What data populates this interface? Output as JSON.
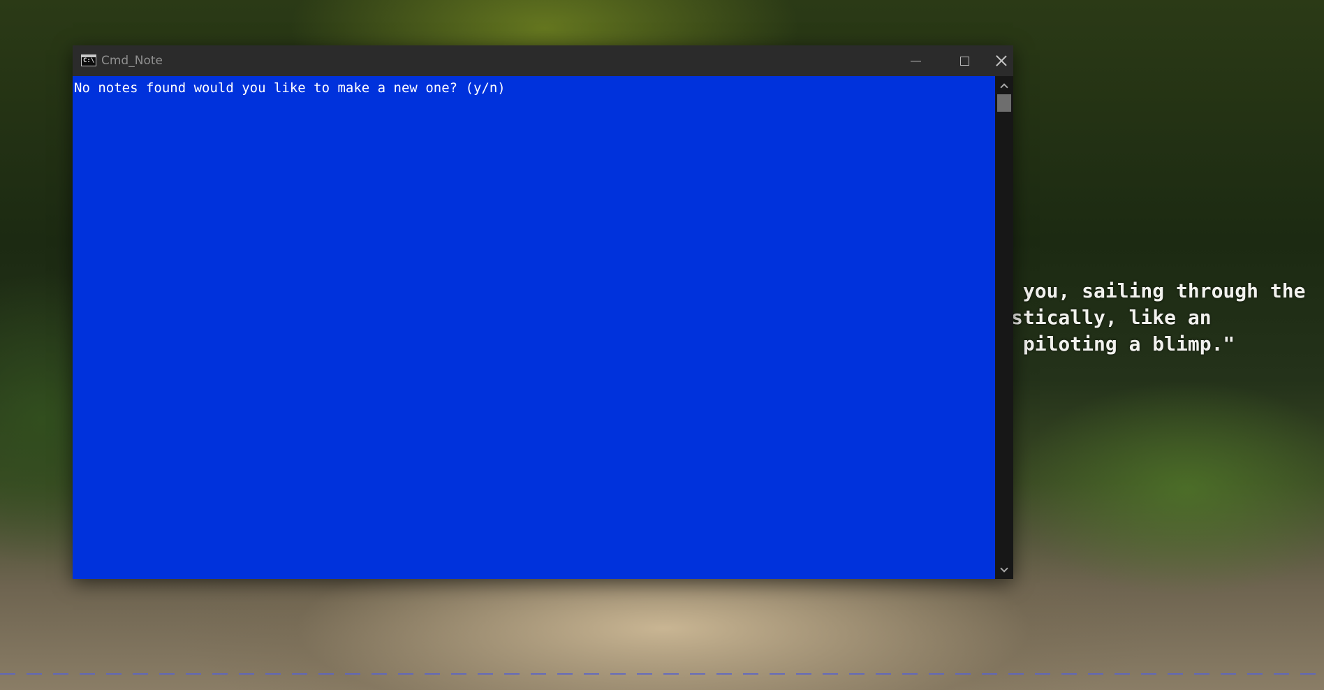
{
  "desktop": {
    "wallpaper_quote": [
      " you, sailing through the",
      "stically, like an",
      " piloting a blimp.\""
    ]
  },
  "window": {
    "title": "Cmd_Note",
    "icon": "command-prompt-icon",
    "icon_text": "C:\\",
    "controls": {
      "minimize": "minimize-icon",
      "maximize": "maximize-icon",
      "close": "close-icon"
    }
  },
  "console": {
    "background_color": "#0032dc",
    "text_color": "#ffffff",
    "lines": [
      "No notes found would you like to make a new one? (y/n)"
    ]
  },
  "scrollbar": {
    "up_icon": "chevron-up-icon",
    "down_icon": "chevron-down-icon"
  }
}
